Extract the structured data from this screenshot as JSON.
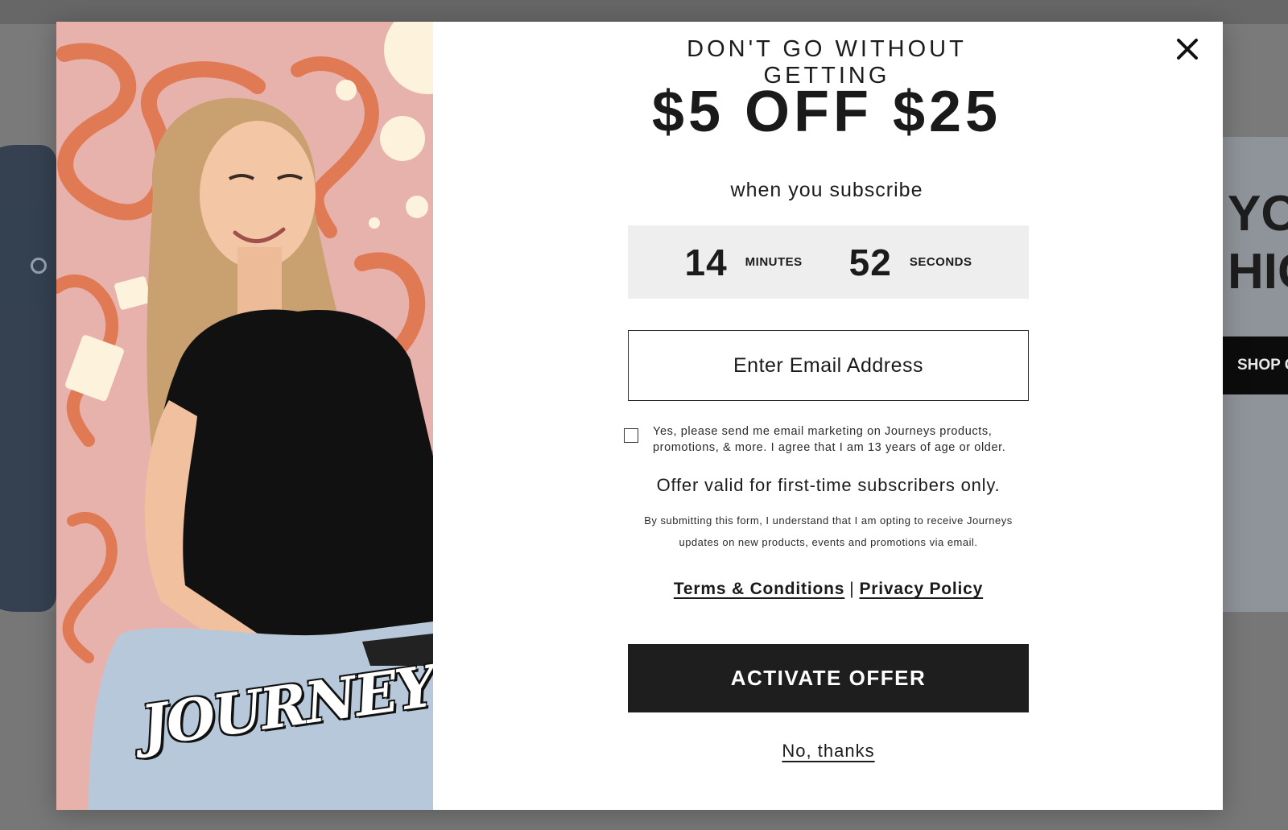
{
  "background": {
    "hero_text_line1": "YO",
    "hero_text_line2": "HIG",
    "shop_button": "SHOP C"
  },
  "modal": {
    "brand_logo": "JOURNEYS",
    "kicker": "DON'T GO WITHOUT GETTING",
    "headline": "$5 OFF $25",
    "subhead": "when you subscribe",
    "timer": {
      "minutes_value": "14",
      "minutes_label": "MINUTES",
      "seconds_value": "52",
      "seconds_label": "SECONDS"
    },
    "email": {
      "placeholder": "Enter Email Address",
      "value": ""
    },
    "consent_checked": false,
    "consent_text": "Yes, please send me email marketing on Journeys products, promotions, & more. I agree that I am 13 years of age or older.",
    "validity_text": "Offer valid for first-time subscribers only.",
    "legal_text": "By submitting this form, I understand that I am opting to receive Journeys updates on new products, events and promotions via email.",
    "terms_link": "Terms & Conditions",
    "link_separator": "|",
    "privacy_link": "Privacy Policy",
    "cta_label": "ACTIVATE OFFER",
    "decline_label": "No, thanks",
    "close_icon": "close-icon"
  },
  "colors": {
    "overlay": "#6f6f6f",
    "cta_background": "#1e1e1e",
    "timer_background": "#eeeeee",
    "hero_pink": "#e9b3ad",
    "hero_orange": "#e07a55",
    "hero_cream": "#fdf3dc"
  }
}
